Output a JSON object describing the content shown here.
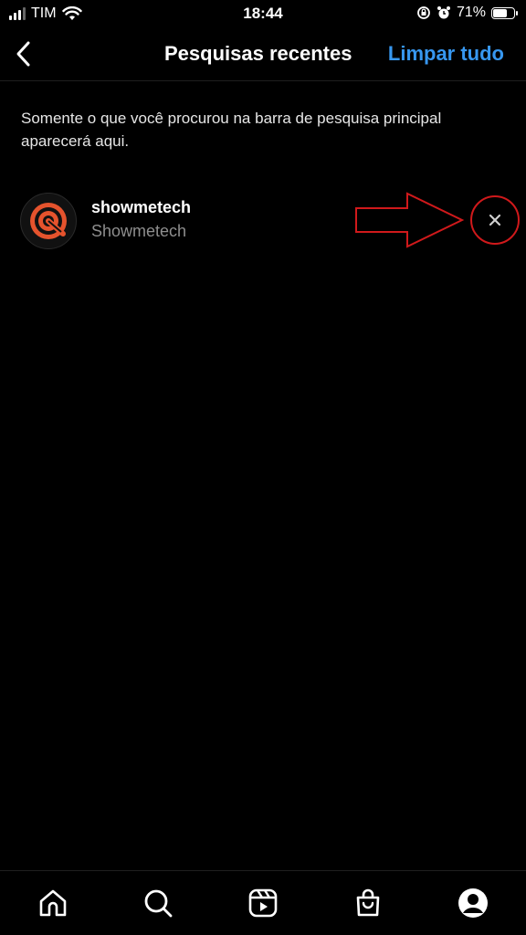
{
  "status_bar": {
    "carrier": "TIM",
    "time": "18:44",
    "battery_percent": "71%",
    "battery_level": 0.71,
    "icons": [
      "signal-icon",
      "wifi-icon",
      "rotation-lock-icon",
      "alarm-icon",
      "battery-icon"
    ]
  },
  "header": {
    "back_icon": "chevron-left-icon",
    "title": "Pesquisas recentes",
    "clear_all": "Limpar tudo",
    "accent_color": "#3797f0"
  },
  "info_text": "Somente o que você procurou na barra de pesquisa principal aparecerá aqui.",
  "recent_searches": [
    {
      "username": "showmetech",
      "full_name": "Showmetech",
      "avatar_icon": "showmetech-logo-icon",
      "remove_icon": "close-icon"
    }
  ],
  "annotation": {
    "arrow_color": "#d0191b",
    "circle_color": "#d0191b"
  },
  "bottom_nav": {
    "items": [
      "home-icon",
      "search-icon",
      "reels-icon",
      "shop-icon",
      "profile-icon"
    ]
  }
}
